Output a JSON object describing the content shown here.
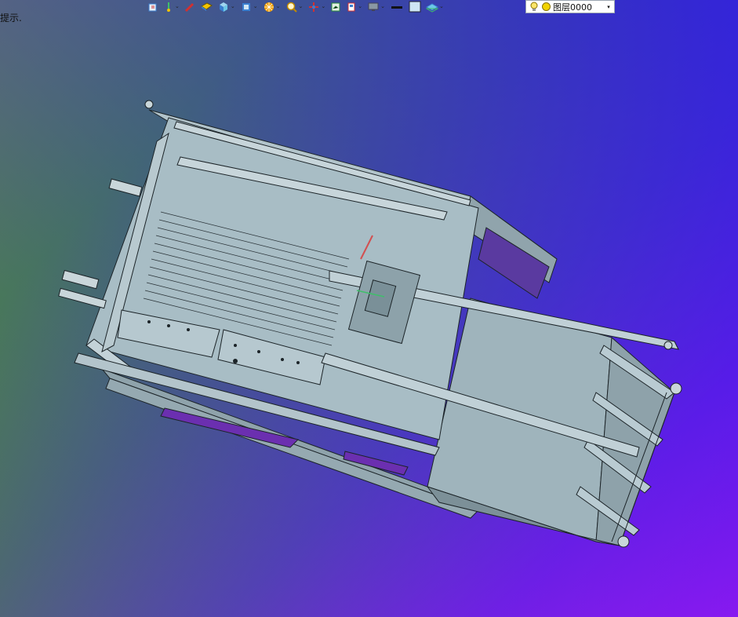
{
  "hint": {
    "text": "提示."
  },
  "toolbar": {
    "buttons": [
      {
        "name": "insert-icon",
        "has_caret": false
      },
      {
        "name": "pointer-icon",
        "has_caret": true
      },
      {
        "name": "pen-icon",
        "has_caret": false
      },
      {
        "name": "box-yellow-icon",
        "has_caret": false
      },
      {
        "name": "cube-icon",
        "has_caret": true
      },
      {
        "name": "view-cube-icon",
        "has_caret": true
      },
      {
        "name": "render-wheel-icon",
        "has_caret": true
      },
      {
        "name": "zoom-icon",
        "has_caret": true
      },
      {
        "name": "axis-icon",
        "has_caret": true
      },
      {
        "name": "frame-icon",
        "has_caret": false
      },
      {
        "name": "section-icon",
        "has_caret": true
      },
      {
        "name": "display-icon",
        "has_caret": true
      },
      {
        "name": "line-weight-icon",
        "has_caret": false
      },
      {
        "name": "color-swatch-icon",
        "has_caret": false
      },
      {
        "name": "layer-state-icon",
        "has_caret": true
      }
    ],
    "colors": {
      "accent": "#3a7fd0",
      "yellow": "#f2c400",
      "red": "#d23030",
      "cyan": "#6cc8e8",
      "swatch": "#cfe6f5"
    }
  },
  "layer": {
    "value": "图层0000",
    "bulb_icon": "bulb-icon",
    "sun_icon": "sun-icon"
  },
  "viewport": {
    "model_color": "#a7bcc4",
    "edge_color": "#1c2428"
  }
}
